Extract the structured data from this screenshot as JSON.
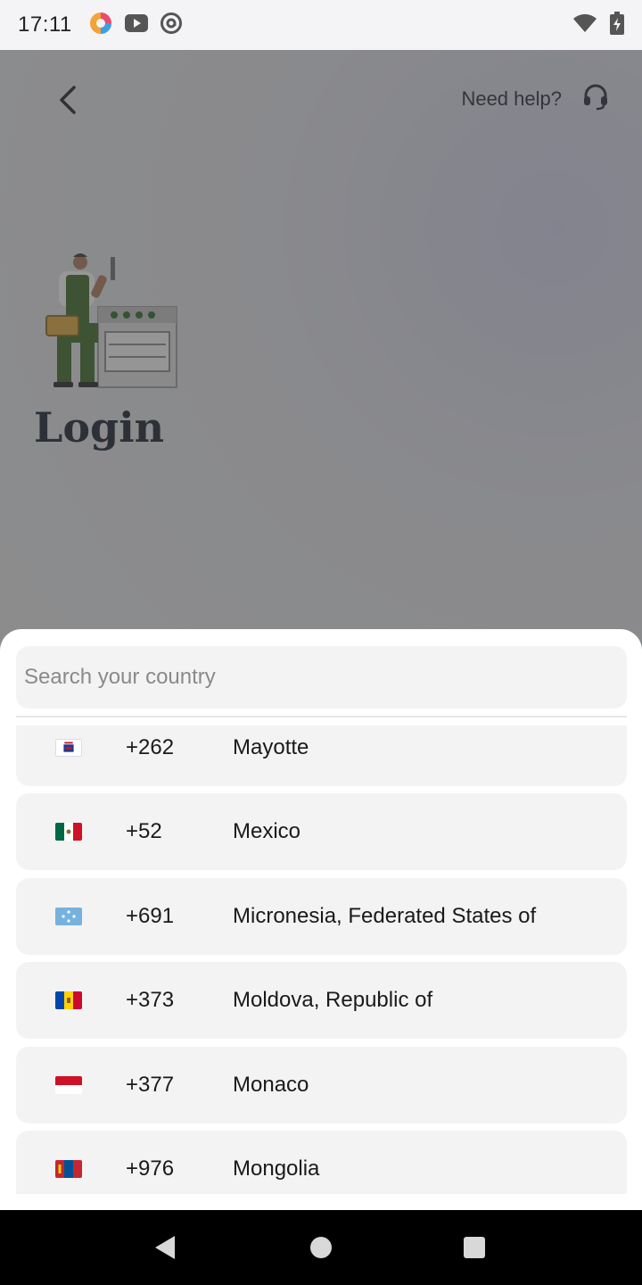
{
  "status_bar": {
    "time": "17:11",
    "left_icons": [
      "app-icon",
      "youtube-icon",
      "at-sign-icon"
    ],
    "right_icons": [
      "wifi-icon",
      "battery-charging-icon"
    ]
  },
  "header": {
    "back_icon": "chevron-left-icon",
    "help_label": "Need help?",
    "help_icon": "headset-icon"
  },
  "page": {
    "title": "Login"
  },
  "country_sheet": {
    "search": {
      "placeholder": "Search your country",
      "value": ""
    },
    "countries": [
      {
        "flag": "flag-yt-icon",
        "code": "+262",
        "name": "Mayotte"
      },
      {
        "flag": "flag-mx-icon",
        "code": "+52",
        "name": "Mexico"
      },
      {
        "flag": "flag-fm-icon",
        "code": "+691",
        "name": "Micronesia, Federated States of"
      },
      {
        "flag": "flag-md-icon",
        "code": "+373",
        "name": "Moldova, Republic of"
      },
      {
        "flag": "flag-mc-icon",
        "code": "+377",
        "name": "Monaco"
      },
      {
        "flag": "flag-mn-icon",
        "code": "+976",
        "name": "Mongolia"
      }
    ]
  },
  "nav_bar": {
    "buttons": [
      "back-triangle-icon",
      "home-circle-icon",
      "recents-square-icon"
    ]
  }
}
